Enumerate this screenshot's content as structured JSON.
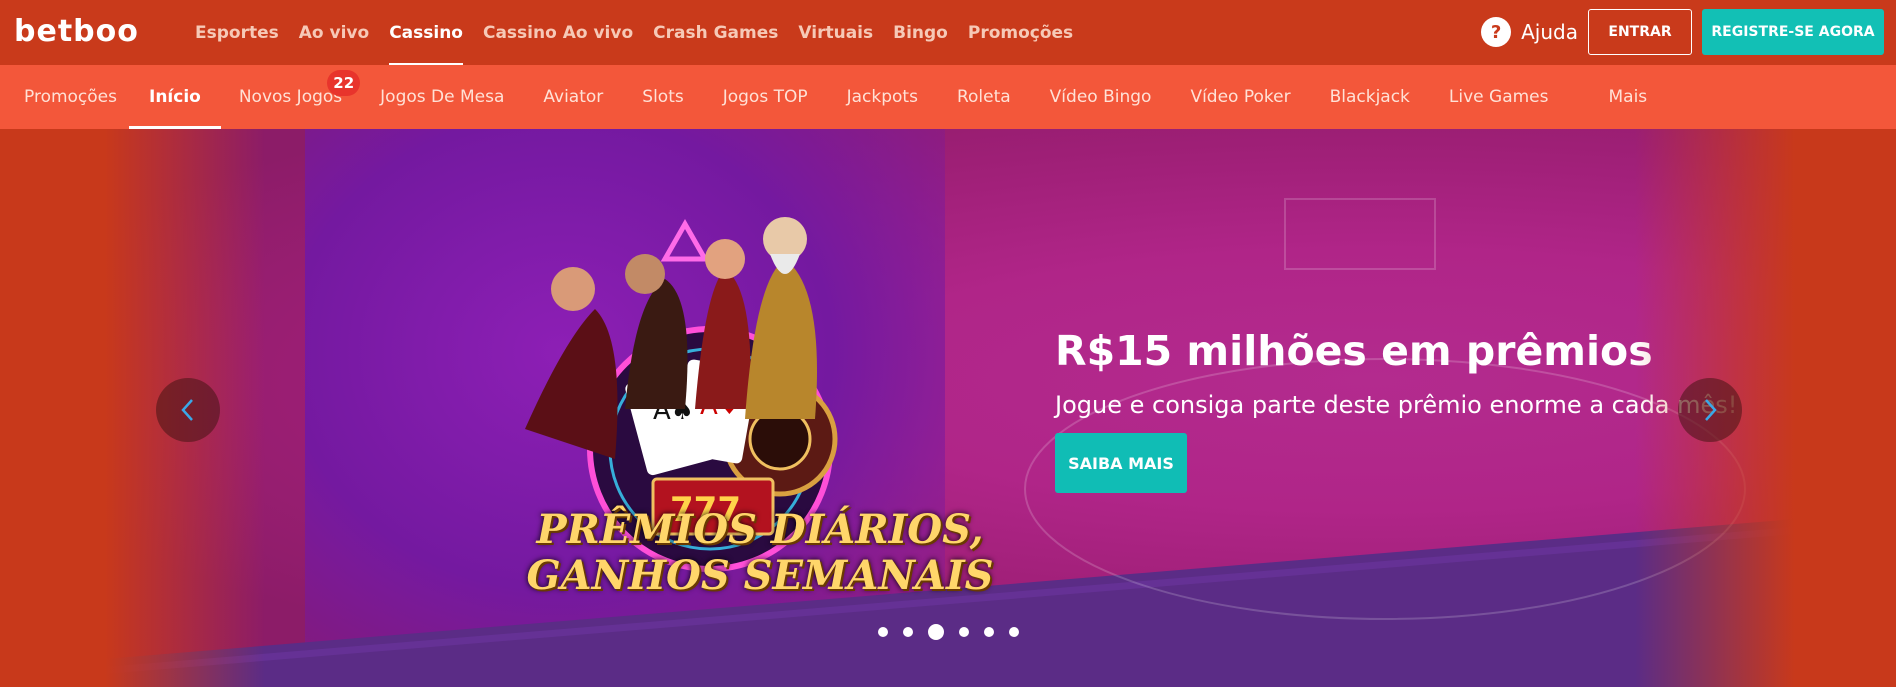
{
  "brand": {
    "logo_text": "betboo"
  },
  "top_nav": {
    "items": [
      {
        "label": "Esportes"
      },
      {
        "label": "Ao vivo"
      },
      {
        "label": "Cassino"
      },
      {
        "label": "Cassino Ao vivo"
      },
      {
        "label": "Crash Games"
      },
      {
        "label": "Virtuais"
      },
      {
        "label": "Bingo"
      },
      {
        "label": "Promoções"
      }
    ],
    "active": "Cassino"
  },
  "header_actions": {
    "help_icon": "question-icon",
    "help_label": "Ajuda",
    "login_label": "ENTRAR",
    "register_label": "REGISTRE-SE AGORA"
  },
  "sub_nav": {
    "items": [
      {
        "label": "Promoções"
      },
      {
        "label": "Início"
      },
      {
        "label": "Novos Jogos",
        "badge": "22"
      },
      {
        "label": "Jogos De Mesa"
      },
      {
        "label": "Aviator"
      },
      {
        "label": "Slots"
      },
      {
        "label": "Jogos TOP"
      },
      {
        "label": "Jackpots"
      },
      {
        "label": "Roleta"
      },
      {
        "label": "Vídeo Bingo"
      },
      {
        "label": "Vídeo Poker"
      },
      {
        "label": "Blackjack"
      },
      {
        "label": "Live Games"
      },
      {
        "label": "Mais"
      }
    ],
    "active": "Início"
  },
  "banner": {
    "art_text_line1": "PRÊMIOS DIÁRIOS,",
    "art_text_line2": "GANHOS SEMANAIS",
    "headline": "R$15 milhões em prêmios",
    "subline": "Jogue e consiga parte deste prêmio enorme a cada mês!",
    "cta_label": "SAIBA MAIS",
    "prev_icon": "chevron-left-icon",
    "next_icon": "chevron-right-icon",
    "slide_count": 6,
    "active_slide": 3
  },
  "colors": {
    "header_bg": "#c93a1b",
    "subnav_bg": "#f3573a",
    "accent_teal": "#12c0b5",
    "badge_red": "#e8342c"
  }
}
